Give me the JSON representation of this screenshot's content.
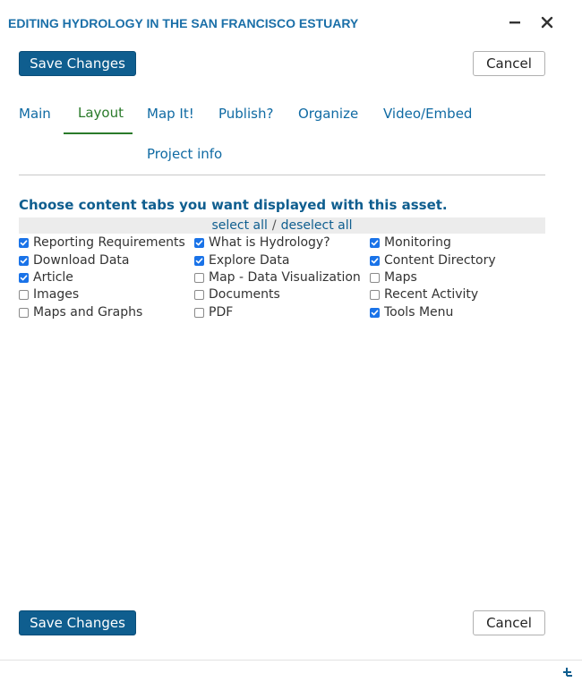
{
  "window": {
    "title": "EDITING HYDROLOGY IN THE SAN FRANCISCO ESTUARY"
  },
  "buttons": {
    "save_label": "Save Changes",
    "cancel_label": "Cancel"
  },
  "tabs": [
    {
      "label": "Main",
      "active": false
    },
    {
      "label": "Layout",
      "active": true
    },
    {
      "label": "Map It!",
      "active": false
    },
    {
      "label": "Publish?",
      "active": false
    },
    {
      "label": "Organize",
      "active": false
    },
    {
      "label": "Video/Embed",
      "active": false
    },
    {
      "label": "Project info",
      "active": false
    }
  ],
  "layout": {
    "heading": "Choose content tabs you want displayed with this asset.",
    "select_all": "select all",
    "separator": "/",
    "deselect_all": "deselect all",
    "options": [
      {
        "label": "Reporting Requirements",
        "checked": true
      },
      {
        "label": "What is Hydrology?",
        "checked": true
      },
      {
        "label": "Monitoring",
        "checked": true
      },
      {
        "label": "Download Data",
        "checked": true
      },
      {
        "label": "Explore Data",
        "checked": true
      },
      {
        "label": "Content Directory",
        "checked": true
      },
      {
        "label": "Article",
        "checked": true
      },
      {
        "label": "Map - Data Visualization",
        "checked": false
      },
      {
        "label": "Maps",
        "checked": false
      },
      {
        "label": "Images",
        "checked": false
      },
      {
        "label": "Documents",
        "checked": false
      },
      {
        "label": "Recent Activity",
        "checked": false
      },
      {
        "label": "Maps and Graphs",
        "checked": false
      },
      {
        "label": "PDF",
        "checked": false
      },
      {
        "label": "Tools Menu",
        "checked": true
      }
    ]
  },
  "colors": {
    "title": "#1a6fa8",
    "primary_button": "#0f5e8f",
    "active_tab": "#2a7a2a",
    "link": "#0f6aa3",
    "checkbox_checked": "#1a73e8"
  },
  "icons": {
    "minimize": "minimize-icon",
    "close": "close-icon",
    "resize": "resize-handle-icon",
    "checkmark": "checkmark-icon"
  }
}
